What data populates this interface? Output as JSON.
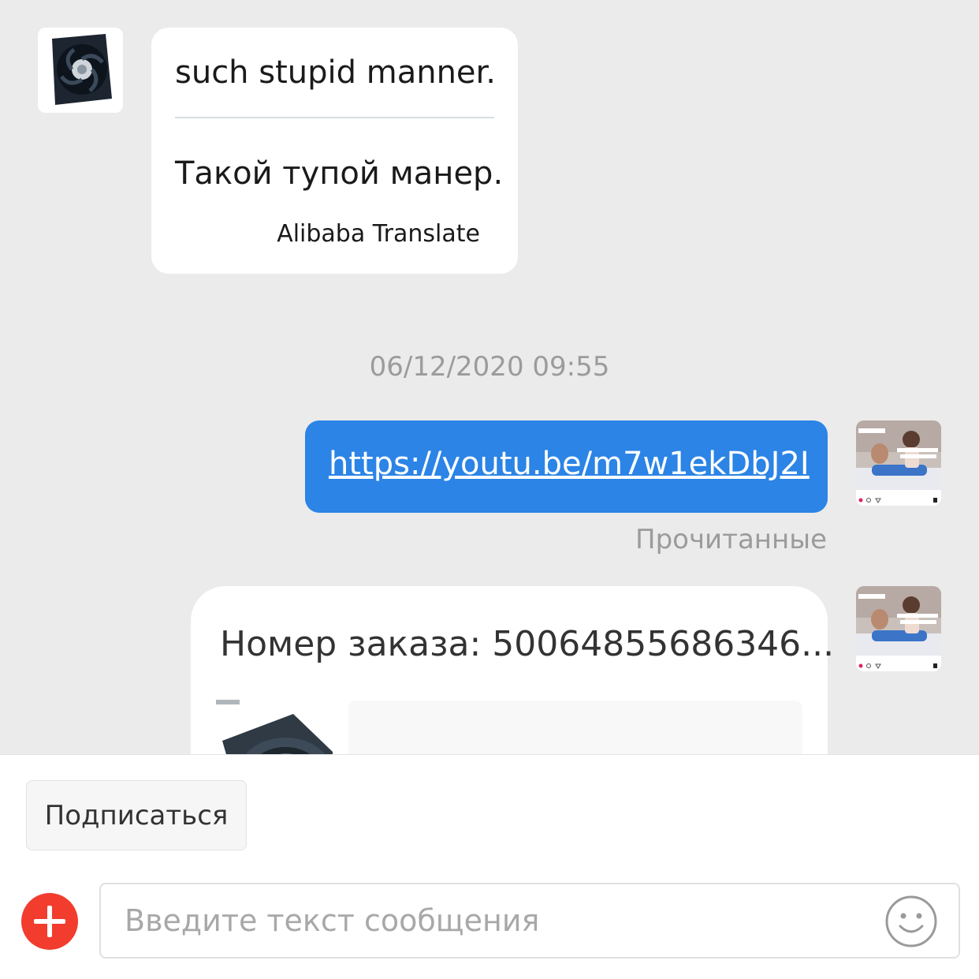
{
  "messages": {
    "incoming": {
      "original_text": "such stupid manner.",
      "translated_text": "Такой тупой манер.",
      "translation_source": "Alibaba Translate"
    },
    "timestamp": "06/12/2020 09:55",
    "outgoing_link": {
      "text": "https://youtu.be/m7w1ekDbJ2I"
    },
    "read_status": "Прочитанные",
    "order_card": {
      "title": "Номер заказа: 50064855686346..."
    }
  },
  "bottom_panel": {
    "subscribe_label": "Подписаться",
    "input_placeholder": "Введите текст сообщения"
  },
  "icons": {
    "add": "plus-icon",
    "emoji": "smiley-icon"
  },
  "colors": {
    "accent_blue": "#2b84e6",
    "add_button_red": "#f23c2e",
    "background": "#ebebeb"
  }
}
